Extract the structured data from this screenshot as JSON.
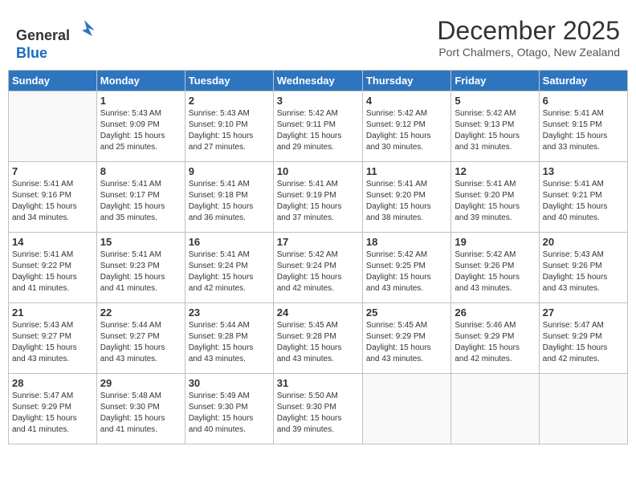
{
  "header": {
    "logo_line1": "General",
    "logo_line2": "Blue",
    "month": "December 2025",
    "location": "Port Chalmers, Otago, New Zealand"
  },
  "weekdays": [
    "Sunday",
    "Monday",
    "Tuesday",
    "Wednesday",
    "Thursday",
    "Friday",
    "Saturday"
  ],
  "weeks": [
    [
      {
        "day": "",
        "info": ""
      },
      {
        "day": "1",
        "info": "Sunrise: 5:43 AM\nSunset: 9:09 PM\nDaylight: 15 hours\nand 25 minutes."
      },
      {
        "day": "2",
        "info": "Sunrise: 5:43 AM\nSunset: 9:10 PM\nDaylight: 15 hours\nand 27 minutes."
      },
      {
        "day": "3",
        "info": "Sunrise: 5:42 AM\nSunset: 9:11 PM\nDaylight: 15 hours\nand 29 minutes."
      },
      {
        "day": "4",
        "info": "Sunrise: 5:42 AM\nSunset: 9:12 PM\nDaylight: 15 hours\nand 30 minutes."
      },
      {
        "day": "5",
        "info": "Sunrise: 5:42 AM\nSunset: 9:13 PM\nDaylight: 15 hours\nand 31 minutes."
      },
      {
        "day": "6",
        "info": "Sunrise: 5:41 AM\nSunset: 9:15 PM\nDaylight: 15 hours\nand 33 minutes."
      }
    ],
    [
      {
        "day": "7",
        "info": "Sunrise: 5:41 AM\nSunset: 9:16 PM\nDaylight: 15 hours\nand 34 minutes."
      },
      {
        "day": "8",
        "info": "Sunrise: 5:41 AM\nSunset: 9:17 PM\nDaylight: 15 hours\nand 35 minutes."
      },
      {
        "day": "9",
        "info": "Sunrise: 5:41 AM\nSunset: 9:18 PM\nDaylight: 15 hours\nand 36 minutes."
      },
      {
        "day": "10",
        "info": "Sunrise: 5:41 AM\nSunset: 9:19 PM\nDaylight: 15 hours\nand 37 minutes."
      },
      {
        "day": "11",
        "info": "Sunrise: 5:41 AM\nSunset: 9:20 PM\nDaylight: 15 hours\nand 38 minutes."
      },
      {
        "day": "12",
        "info": "Sunrise: 5:41 AM\nSunset: 9:20 PM\nDaylight: 15 hours\nand 39 minutes."
      },
      {
        "day": "13",
        "info": "Sunrise: 5:41 AM\nSunset: 9:21 PM\nDaylight: 15 hours\nand 40 minutes."
      }
    ],
    [
      {
        "day": "14",
        "info": "Sunrise: 5:41 AM\nSunset: 9:22 PM\nDaylight: 15 hours\nand 41 minutes."
      },
      {
        "day": "15",
        "info": "Sunrise: 5:41 AM\nSunset: 9:23 PM\nDaylight: 15 hours\nand 41 minutes."
      },
      {
        "day": "16",
        "info": "Sunrise: 5:41 AM\nSunset: 9:24 PM\nDaylight: 15 hours\nand 42 minutes."
      },
      {
        "day": "17",
        "info": "Sunrise: 5:42 AM\nSunset: 9:24 PM\nDaylight: 15 hours\nand 42 minutes."
      },
      {
        "day": "18",
        "info": "Sunrise: 5:42 AM\nSunset: 9:25 PM\nDaylight: 15 hours\nand 43 minutes."
      },
      {
        "day": "19",
        "info": "Sunrise: 5:42 AM\nSunset: 9:26 PM\nDaylight: 15 hours\nand 43 minutes."
      },
      {
        "day": "20",
        "info": "Sunrise: 5:43 AM\nSunset: 9:26 PM\nDaylight: 15 hours\nand 43 minutes."
      }
    ],
    [
      {
        "day": "21",
        "info": "Sunrise: 5:43 AM\nSunset: 9:27 PM\nDaylight: 15 hours\nand 43 minutes."
      },
      {
        "day": "22",
        "info": "Sunrise: 5:44 AM\nSunset: 9:27 PM\nDaylight: 15 hours\nand 43 minutes."
      },
      {
        "day": "23",
        "info": "Sunrise: 5:44 AM\nSunset: 9:28 PM\nDaylight: 15 hours\nand 43 minutes."
      },
      {
        "day": "24",
        "info": "Sunrise: 5:45 AM\nSunset: 9:28 PM\nDaylight: 15 hours\nand 43 minutes."
      },
      {
        "day": "25",
        "info": "Sunrise: 5:45 AM\nSunset: 9:29 PM\nDaylight: 15 hours\nand 43 minutes."
      },
      {
        "day": "26",
        "info": "Sunrise: 5:46 AM\nSunset: 9:29 PM\nDaylight: 15 hours\nand 42 minutes."
      },
      {
        "day": "27",
        "info": "Sunrise: 5:47 AM\nSunset: 9:29 PM\nDaylight: 15 hours\nand 42 minutes."
      }
    ],
    [
      {
        "day": "28",
        "info": "Sunrise: 5:47 AM\nSunset: 9:29 PM\nDaylight: 15 hours\nand 41 minutes."
      },
      {
        "day": "29",
        "info": "Sunrise: 5:48 AM\nSunset: 9:30 PM\nDaylight: 15 hours\nand 41 minutes."
      },
      {
        "day": "30",
        "info": "Sunrise: 5:49 AM\nSunset: 9:30 PM\nDaylight: 15 hours\nand 40 minutes."
      },
      {
        "day": "31",
        "info": "Sunrise: 5:50 AM\nSunset: 9:30 PM\nDaylight: 15 hours\nand 39 minutes."
      },
      {
        "day": "",
        "info": ""
      },
      {
        "day": "",
        "info": ""
      },
      {
        "day": "",
        "info": ""
      }
    ]
  ]
}
